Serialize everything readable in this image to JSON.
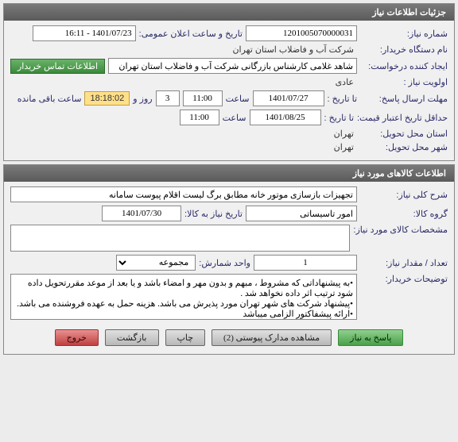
{
  "panels": {
    "info": {
      "title": "جزئیات اطلاعات نیاز"
    },
    "goods": {
      "title": "اطلاعات کالاهای مورد نیاز"
    }
  },
  "labels": {
    "req_no": "شماره نیاز:",
    "announce_time": "تاریخ و ساعت اعلان عمومی:",
    "buyer_org": "نام دستگاه خریدار:",
    "creator": "ایجاد کننده درخواست:",
    "contact_buyer": "اطلاعات تماس خریدار",
    "priority": "اولویت نیاز :",
    "deadline": "مهلت ارسال پاسخ:",
    "to_date": "تا تاریخ :",
    "hour": "ساعت",
    "days_and": "روز و",
    "remaining": "ساعت باقی مانده",
    "validity": "حداقل تاریخ اعتبار قیمت:",
    "delivery_province": "استان محل تحویل:",
    "delivery_city": "شهر محل تحویل:",
    "need_desc": "شرح کلی نیاز:",
    "goods_group": "گروه کالا:",
    "need_date": "تاریخ نیاز به کالا:",
    "goods_spec": "مشخصات کالای مورد نیاز:",
    "qty": "تعداد / مقدار نیاز:",
    "unit_count": "واحد شمارش:",
    "buyer_notes": "توضیحات خریدار:"
  },
  "values": {
    "req_no": "1201005070000031",
    "announce_time": "1401/07/23 - 16:11",
    "buyer_org": "شرکت آب و فاضلاب استان تهران",
    "creator": "شاهد غلامی کارشناس بازرگانی شرکت آب و فاضلاب استان تهران",
    "priority": "عادی",
    "deadline_date": "1401/07/27",
    "deadline_hour": "11:00",
    "remain_days": "3",
    "remain_clock": "18:18:02",
    "validity_date": "1401/08/25",
    "validity_hour": "11:00",
    "delivery_province": "تهران",
    "delivery_city": "تهران",
    "need_desc": "تجهیزات بازسازی موتور خانه مطابق برگ لیست اقلام پیوست سامانه",
    "goods_group": "امور تاسیساتی",
    "need_date": "1401/07/30",
    "goods_spec": "",
    "qty": "1",
    "unit_count_selected": "مجموعه",
    "buyer_notes": "•به پیشنهاداتی که مشروط ، مبهم و بدون مهر و امضاء باشد و یا بعد از موعد مقررتحویل داده شود ترتیب اثر داده نخواهد شد .\n•پیشنهاد شرکت های شهر تهران مورد پذیرش می باشد. هزینه حمل به عهده فروشنده می باشد.\n•ارائه پیشفاکتور الزامی میباشد"
  },
  "buttons": {
    "reply": "پاسخ به نیاز",
    "attachments": "مشاهده مدارک پیوستی (2)",
    "print": "چاپ",
    "back": "بازگشت",
    "exit": "خروج"
  }
}
